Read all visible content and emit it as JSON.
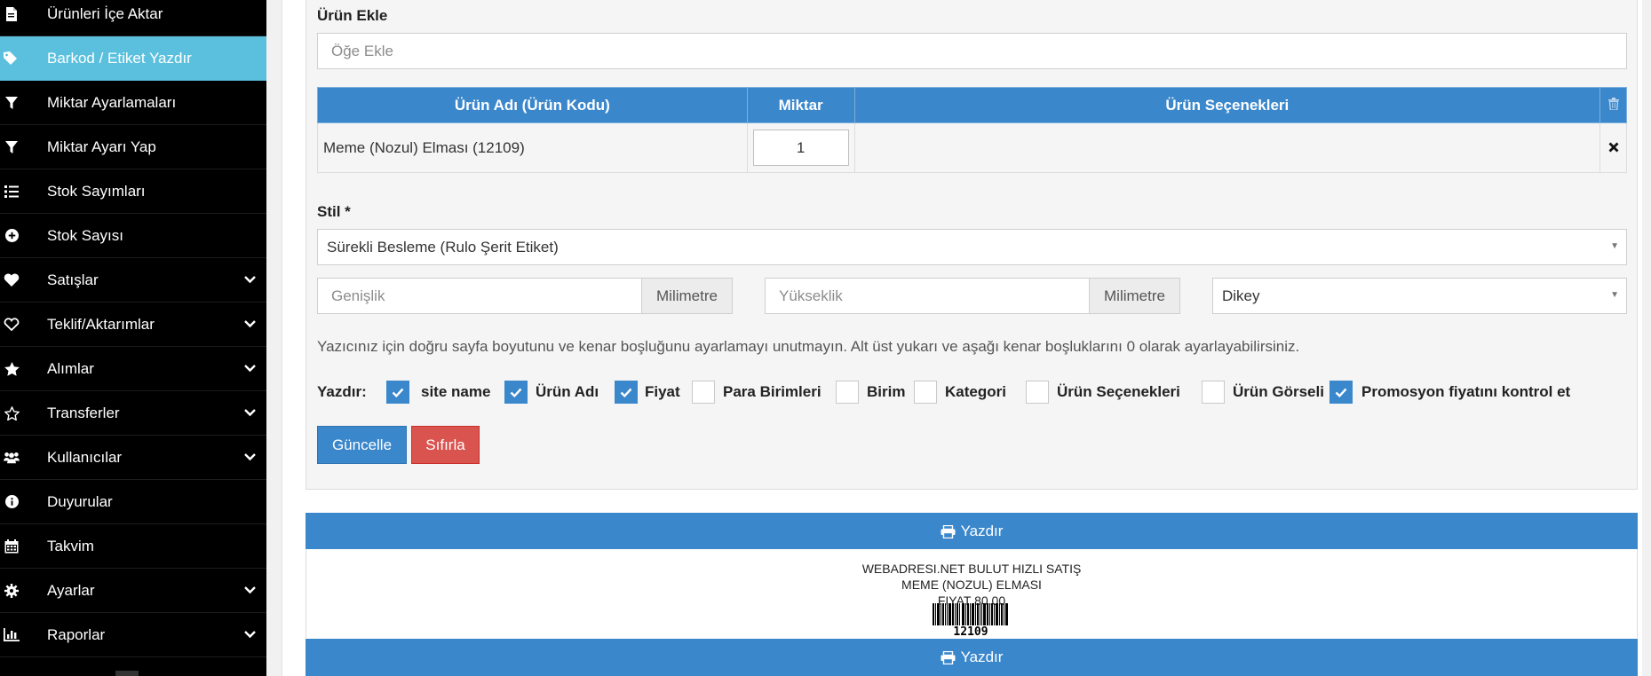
{
  "sidebar": {
    "items": [
      {
        "label": "Ürünleri İçe Aktar",
        "icon": "file-icon",
        "expandable": false
      },
      {
        "label": "Barkod / Etiket Yazdır",
        "icon": "tags-icon",
        "expandable": false,
        "active": true
      },
      {
        "label": "Miktar Ayarlamaları",
        "icon": "filter-icon",
        "expandable": false
      },
      {
        "label": "Miktar Ayarı Yap",
        "icon": "filter-icon",
        "expandable": false
      },
      {
        "label": "Stok Sayımları",
        "icon": "list-icon",
        "expandable": false
      },
      {
        "label": "Stok Sayısı",
        "icon": "plus-circle-icon",
        "expandable": false
      },
      {
        "label": "Satışlar",
        "icon": "heart-icon",
        "expandable": true
      },
      {
        "label": "Teklif/Aktarımlar",
        "icon": "heart-outline-icon",
        "expandable": true
      },
      {
        "label": "Alımlar",
        "icon": "star-icon",
        "expandable": true
      },
      {
        "label": "Transferler",
        "icon": "star-outline-icon",
        "expandable": true
      },
      {
        "label": "Kullanıcılar",
        "icon": "users-icon",
        "expandable": true
      },
      {
        "label": "Duyurular",
        "icon": "info-icon",
        "expandable": false
      },
      {
        "label": "Takvim",
        "icon": "calendar-icon",
        "expandable": false
      },
      {
        "label": "Ayarlar",
        "icon": "gear-icon",
        "expandable": true
      },
      {
        "label": "Raporlar",
        "icon": "bar-chart-icon",
        "expandable": true
      }
    ]
  },
  "form": {
    "add_title": "Ürün Ekle",
    "add_placeholder": "Öğe Ekle",
    "table": {
      "headers": [
        "Ürün Adı (Ürün Kodu)",
        "Miktar",
        "Ürün Seçenekleri"
      ],
      "rows": [
        {
          "name": "Meme (Nozul) Elması (12109)",
          "quantity": "1",
          "options": ""
        }
      ]
    },
    "style_label": "Stil *",
    "style_value": "Sürekli Besleme (Rulo Şerit Etiket)",
    "width_placeholder": "Genişlik",
    "height_placeholder": "Yükseklik",
    "unit_label": "Milimetre",
    "orientation_value": "Dikey",
    "help_text": "Yazıcınız için doğru sayfa boyutunu ve kenar boşluğunu ayarlamayı unutmayın. Alt üst yukarı ve aşağı kenar boşluklarını 0 olarak ayarlayabilirsiniz.",
    "print_label": "Yazdır:",
    "print_options": [
      {
        "label": "site name",
        "checked": true
      },
      {
        "label": "Ürün Adı",
        "checked": true
      },
      {
        "label": "Fiyat",
        "checked": true
      },
      {
        "label": "Para Birimleri",
        "checked": false
      },
      {
        "label": "Birim",
        "checked": false
      },
      {
        "label": "Kategori",
        "checked": false
      },
      {
        "label": "Ürün Seçenekleri",
        "checked": false
      },
      {
        "label": "Ürün Görseli",
        "checked": false
      },
      {
        "label": "Promosyon fiyatını kontrol et",
        "checked": true
      }
    ],
    "update_button": "Güncelle",
    "reset_button": "Sıfırla"
  },
  "preview": {
    "print_button": "Yazdır",
    "site_name": "WEBADRESI.NET BULUT HIZLI SATIŞ",
    "product_name": "MEME (NOZUL) ELMASI",
    "price": "FIYAT 80.00",
    "barcode_number": "12109"
  },
  "colors": {
    "primary": "#3a87cc",
    "danger": "#d9534f",
    "sidebar_active": "#5bc0de",
    "sidebar_bg": "#000000"
  }
}
